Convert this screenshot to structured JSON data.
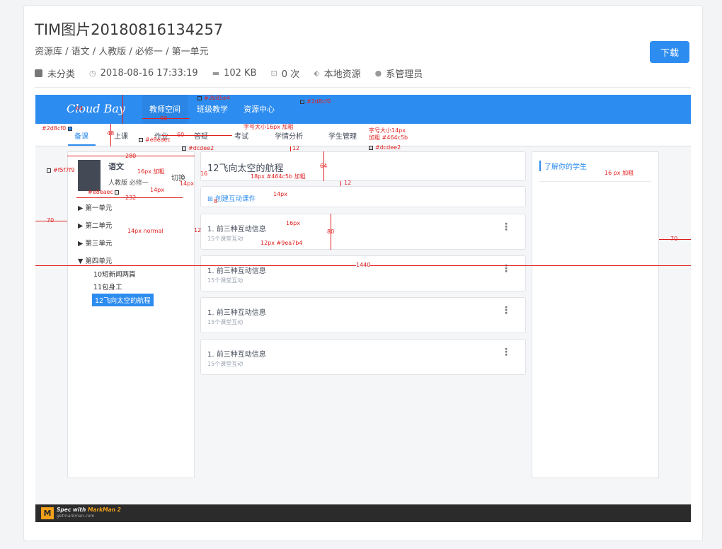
{
  "page": {
    "title": "TIM图片20180816134257",
    "breadcrumb": "资源库 / 语文 / 人教版 / 必修一 / 第一单元",
    "download_label": "下载",
    "meta": {
      "category": "未分类",
      "datetime": "2018-08-16 17:33:19",
      "size": "102 KB",
      "count": "0 次",
      "source": "本地资源",
      "owner": "系管理员"
    }
  },
  "mock": {
    "logo": "Cloud Bay",
    "nav": [
      "教师空间",
      "班级教学",
      "资源中心"
    ],
    "subnav": [
      "备课",
      "上课",
      "作业",
      "答疑",
      "考试",
      "学情分析",
      "学生管理"
    ],
    "left": {
      "subject": "语文",
      "info": "人教版 必修一",
      "switch": "切换",
      "units": [
        "▶ 第一单元",
        "▶ 第二单元",
        "▶ 第三单元",
        "▼ 第四单元"
      ],
      "lessons": [
        "10短新闻两篇",
        "11包身工",
        "12飞向太空的航程"
      ]
    },
    "main": {
      "title": "12飞向太空的航程",
      "create": "创建互动课件",
      "items": [
        {
          "title": "1. 前三种互动信息",
          "sub": "15个课堂互动"
        },
        {
          "title": "1. 前三种互动信息",
          "sub": "15个课堂互动"
        },
        {
          "title": "1. 前三种互动信息",
          "sub": "15个课堂互动"
        },
        {
          "title": "1. 前三种互动信息",
          "sub": "15个课堂互动"
        }
      ]
    },
    "right": {
      "title": "了解你的学生"
    },
    "footer": {
      "brand_a": "Spec with ",
      "brand_b": "MarkMan 2",
      "url": "getmarkman.com"
    }
  },
  "annotations": {
    "c1": "#2b85e4",
    "c2": "#2d8cf0",
    "c3": "#2d8cf0",
    "c4": "#e8eaec",
    "c5": "#dcdee2",
    "c6": "#dcdee2",
    "c7": "#f5f7f9",
    "c8": "#e8eaec",
    "m64": "64",
    "m96": "96",
    "m48": "48",
    "m60": "60",
    "m280": "280",
    "m12a": "12",
    "m64b": "64",
    "m12b": "12",
    "m16": "16",
    "m232": "232",
    "m8": "8",
    "m12c": "12",
    "m80": "80",
    "m70a": "70",
    "m70b": "70",
    "m1440": "1440",
    "t1": "字号大小16px 加粗",
    "t2a": "字号大小14px",
    "t2b": "加粗 #464c5b",
    "t3": "16px 加粗",
    "t4": "14px",
    "t5": "14px",
    "t6": "18px #464c5b 加粗",
    "t7": "14px",
    "t8": "16px",
    "t9": "12px #9ea7b4",
    "t10": "14px normal",
    "t11": "16 px 加粗"
  },
  "colors": {
    "primary": "#2d8cf0",
    "primary_dark": "#2b85e4",
    "text": "#464c5b",
    "muted": "#9ea7b4",
    "annotation": "#e02020",
    "bg": "#f5f7f9"
  }
}
